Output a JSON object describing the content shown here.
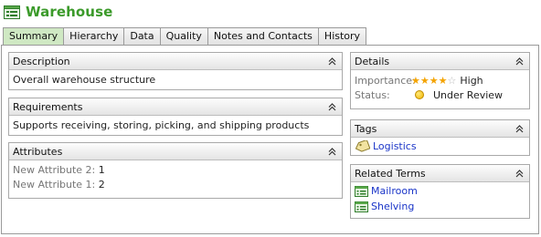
{
  "title": "Warehouse",
  "tabs": [
    {
      "label": "Summary",
      "active": true
    },
    {
      "label": "Hierarchy",
      "active": false
    },
    {
      "label": "Data",
      "active": false
    },
    {
      "label": "Quality",
      "active": false
    },
    {
      "label": "Notes and Contacts",
      "active": false
    },
    {
      "label": "History",
      "active": false
    }
  ],
  "description": {
    "header": "Description",
    "text": "Overall warehouse structure"
  },
  "requirements": {
    "header": "Requirements",
    "text": "Supports receiving, storing, picking, and shipping products"
  },
  "attributes": {
    "header": "Attributes",
    "rows": [
      {
        "label": "New Attribute 2:",
        "value": "1"
      },
      {
        "label": "New Attribute 1:",
        "value": "2"
      }
    ]
  },
  "details": {
    "header": "Details",
    "importance_label": "Importance:",
    "importance_rating": 4,
    "importance_max": 5,
    "importance_value": "High",
    "status_label": "Status:",
    "status_value": "Under Review"
  },
  "tags": {
    "header": "Tags",
    "items": [
      "Logistics"
    ]
  },
  "related_terms": {
    "header": "Related Terms",
    "items": [
      "Mailroom",
      "Shelving"
    ]
  },
  "colors": {
    "title": "#3b9a2a",
    "active_tab": "#cfe8c3",
    "link": "#1a35c8",
    "star": "#f4a300",
    "status": "#f0b400"
  }
}
